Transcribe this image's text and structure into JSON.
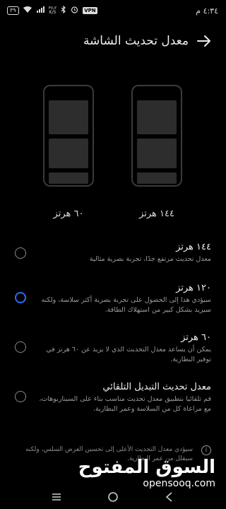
{
  "status_bar": {
    "time": "٤:٣٤ م",
    "battery": "٣٩",
    "network_speed_value": "٣٧٫٢",
    "network_speed_unit": "K/S",
    "vpn": "VPN"
  },
  "header": {
    "title": "معدل تحديث الشاشة",
    "back_icon": "arrow-forward-icon"
  },
  "previews": [
    {
      "label": "١٤٤ هرتز"
    },
    {
      "label": "٦٠ هرتز"
    }
  ],
  "options": [
    {
      "title": "١٤٤ هرتز",
      "description": "معدل تحديث مرتفع جدًا، تجربة بصرية مثالية",
      "selected": false
    },
    {
      "title": "١٢٠ هرتز",
      "description": "سيؤدي هذا إلى الحصول على تجربة بصرية أكثر سلاسة، ولكنه سيزيد بشكل كبير من استهلاك الطاقة.",
      "selected": true
    },
    {
      "title": "٦٠ هرتز",
      "description": "يمكن أن يساعد معدل التحديث الذي لا يزيد عن ٦٠ هرتز في توفير البطارية.",
      "selected": false
    },
    {
      "title": "معدل تحديث التبديل التلقائي",
      "description": "قم تلقائيا بتطبيق معدل تحديث مناسب بناء على السيناريوهات، مع مراعاة كل من السلاسة وعمر البطارية.",
      "selected": false
    }
  ],
  "footer_note": "سيؤدي معدل التحديث الأعلى إلى تحسين العرض السلس، ولكنه سيقلل من عمر البطارية.",
  "watermark": {
    "arabic": "السوق المفتوح",
    "english": "opensooq.com"
  },
  "colors": {
    "accent": "#2f6bff",
    "background": "#000000"
  }
}
